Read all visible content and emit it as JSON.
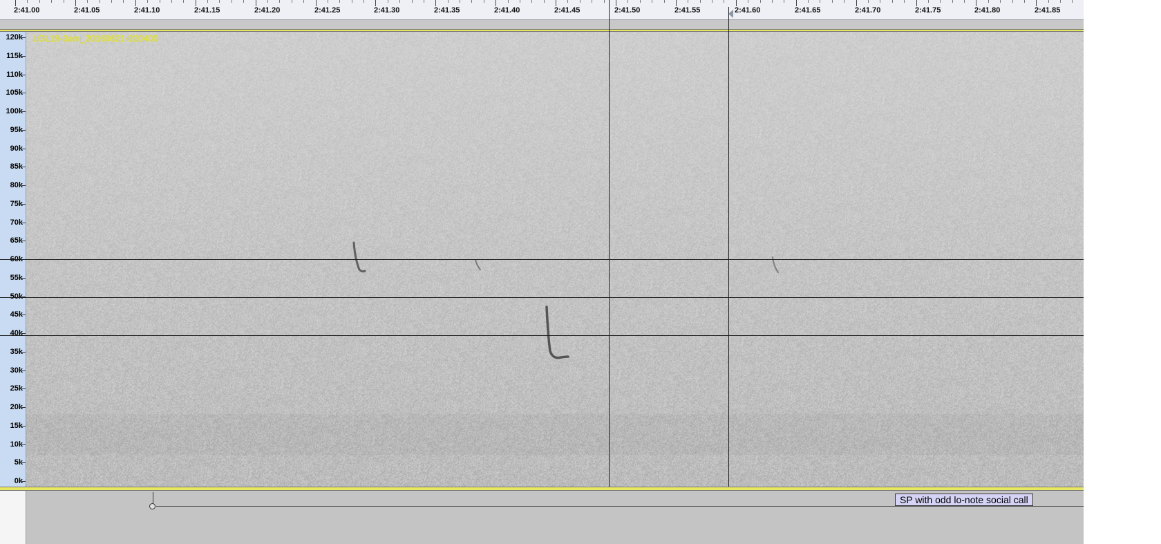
{
  "ruler": {
    "labels": [
      "2:41.00",
      "2:41.05",
      "2:41.10",
      "2:41.15",
      "2:41.20",
      "2:41.25",
      "2:41.30",
      "2:41.35",
      "2:41.40",
      "2:41.45",
      "2:41.50",
      "2:41.55",
      "2:41.60",
      "2:41.65",
      "2:41.70",
      "2:41.75",
      "2:41.80",
      "2:41.85"
    ]
  },
  "track": {
    "title": "LGL18-3am_20160621-220400",
    "freq_labels": [
      "120k",
      "115k",
      "110k",
      "105k",
      "100k",
      "95k",
      "90k",
      "85k",
      "80k",
      "75k",
      "70k",
      "65k",
      "60k",
      "55k",
      "50k",
      "45k",
      "40k",
      "35k",
      "30k",
      "25k",
      "20k",
      "15k",
      "10k",
      "5k",
      "0k"
    ]
  },
  "label_track": {
    "label": "SP with odd lo-note social call"
  },
  "colors": {
    "ruler_bg": "#eef0f5",
    "freq_ruler_bg": "#c9dbf2",
    "track_border": "#e8e860",
    "title_color": "#e8e830",
    "label_bg": "#d6d4f6"
  }
}
